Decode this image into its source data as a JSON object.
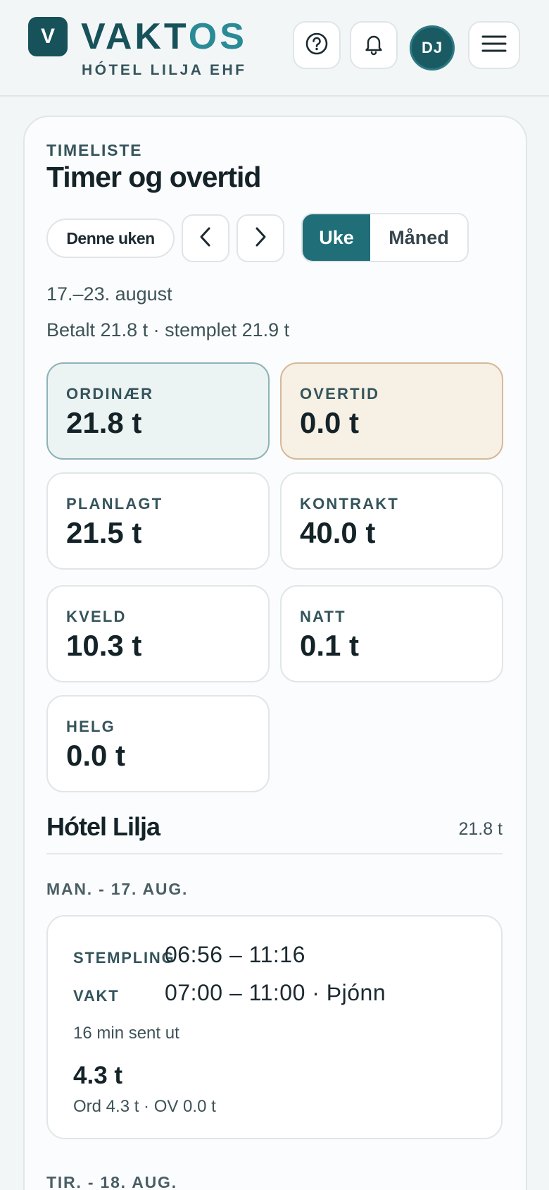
{
  "header": {
    "logo_letter": "V",
    "brand_part1": "VAKT",
    "brand_part2": "OS",
    "hotel": "HÓTEL LILJA EHF",
    "avatar_initials": "DJ"
  },
  "page": {
    "eyebrow": "TIMELISTE",
    "title": "Timer og overtid",
    "this_week": "Denne uken",
    "view_week": "Uke",
    "view_month": "Måned",
    "range": "17.–23. august",
    "paid_summary": "Betalt 21.8 t · stemplet 21.9 t"
  },
  "stats": {
    "ordinary": {
      "label": "ORDINÆR",
      "value": "21.8 t"
    },
    "overtime": {
      "label": "OVERTID",
      "value": "0.0 t"
    },
    "planned": {
      "label": "PLANLAGT",
      "value": "21.5 t"
    },
    "contract": {
      "label": "KONTRAKT",
      "value": "40.0 t"
    },
    "evening": {
      "label": "KVELD",
      "value": "10.3 t"
    },
    "night": {
      "label": "NATT",
      "value": "0.1 t"
    },
    "weekend": {
      "label": "HELG",
      "value": "0.0 t"
    }
  },
  "location": {
    "name": "Hótel Lilja",
    "total": "21.8 t"
  },
  "days": [
    {
      "label": "MAN. - 17. AUG.",
      "stamp_label": "STEMPLING",
      "stamp": "06:56 – 11:16",
      "shift_label": "VAKT",
      "shift": "07:00 – 11:00 · Þjónn",
      "note": "16 min sent ut",
      "hours": "4.3 t",
      "split": "Ord 4.3 t · OV 0.0 t"
    },
    {
      "label": "TIR. - 18. AUG."
    }
  ],
  "colors": {
    "primary": "#17525a",
    "accent": "#2a8a96",
    "active_segment": "#1f6e78",
    "ordinary_bg": "#ecf3f3",
    "overtime_bg": "#f6f0e5"
  }
}
